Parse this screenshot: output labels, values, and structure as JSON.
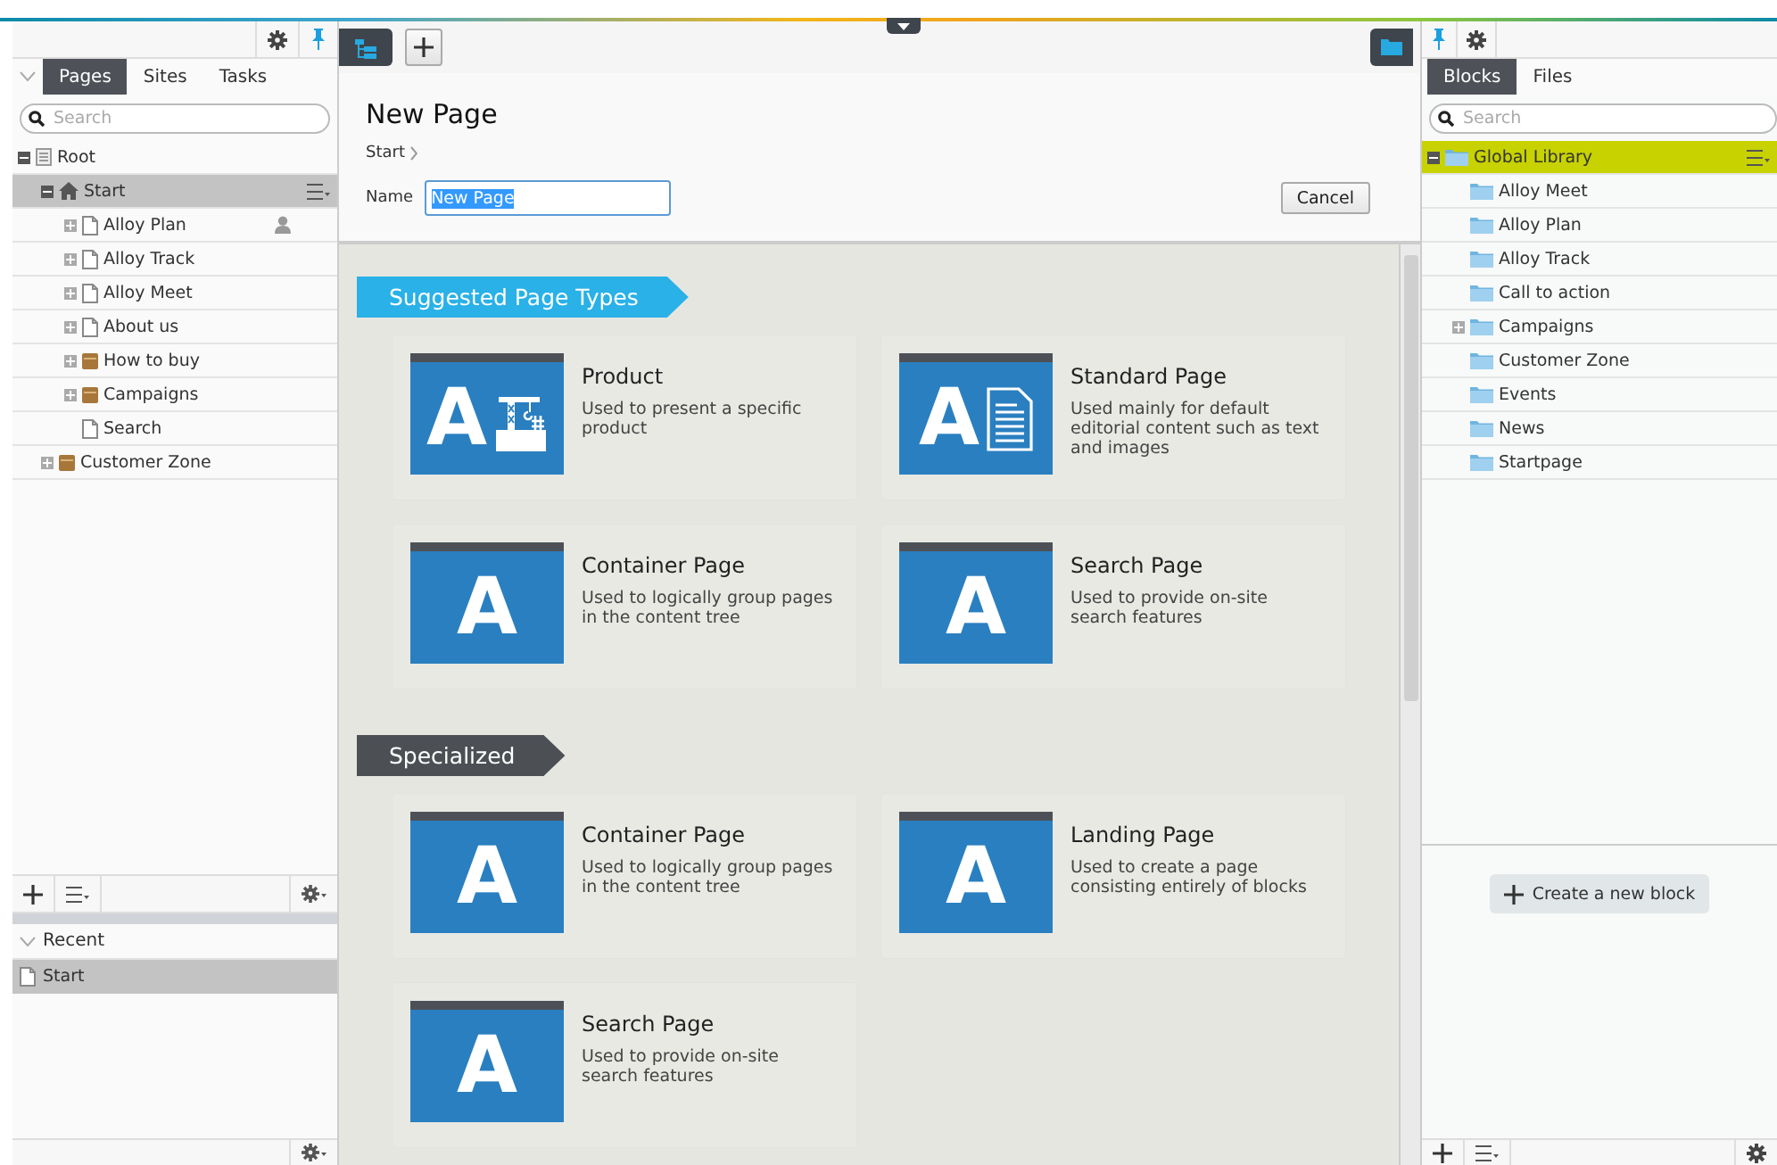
{
  "header_toggle": {
    "expanded": false
  },
  "left_pane": {
    "tabs": [
      {
        "label": "Pages",
        "selected": true
      },
      {
        "label": "Sites",
        "selected": false
      },
      {
        "label": "Tasks",
        "selected": false
      }
    ],
    "search": {
      "placeholder": "Search"
    },
    "tree": [
      {
        "label": "Root",
        "kind": "root",
        "has_children": true,
        "expanded": true,
        "selected": false,
        "in_use": false,
        "children": [
          {
            "label": "Start",
            "kind": "home",
            "has_children": true,
            "expanded": true,
            "selected": true,
            "in_use": false,
            "children": [
              {
                "label": "Alloy Plan",
                "kind": "page",
                "has_children": true,
                "expanded": false,
                "selected": false,
                "in_use": true
              },
              {
                "label": "Alloy Track",
                "kind": "page",
                "has_children": true,
                "expanded": false,
                "selected": false,
                "in_use": false
              },
              {
                "label": "Alloy Meet",
                "kind": "page",
                "has_children": true,
                "expanded": false,
                "selected": false,
                "in_use": false
              },
              {
                "label": "About us",
                "kind": "page",
                "has_children": true,
                "expanded": false,
                "selected": false,
                "in_use": false
              },
              {
                "label": "How to buy",
                "kind": "container",
                "has_children": true,
                "expanded": false,
                "selected": false,
                "in_use": false
              },
              {
                "label": "Campaigns",
                "kind": "container",
                "has_children": true,
                "expanded": false,
                "selected": false,
                "in_use": false
              },
              {
                "label": "Search",
                "kind": "page",
                "has_children": false,
                "selected": false,
                "in_use": false
              }
            ]
          },
          {
            "label": "Customer Zone",
            "kind": "container",
            "has_children": true,
            "expanded": false,
            "selected": false,
            "in_use": false
          }
        ]
      }
    ]
  },
  "recent": {
    "title": "Recent",
    "items": [
      {
        "label": "Start",
        "selected": true
      }
    ]
  },
  "main": {
    "title": "New Page",
    "breadcrumb": [
      {
        "label": "Start"
      }
    ],
    "name_field": {
      "label": "Name",
      "value": "New Page",
      "text_selected": true
    },
    "cancel_button": "Cancel",
    "sections": [
      {
        "title": "Suggested Page Types",
        "kind": "suggested",
        "page_types": [
          {
            "name": "Product",
            "description": "Used to present a specific product",
            "thumbnail_text": "A",
            "kind": "crane"
          },
          {
            "name": "Standard Page",
            "description": "Used mainly for default editorial content such as text and images",
            "thumbnail_text": "A",
            "kind": "document"
          },
          {
            "name": "Container Page",
            "description": "Used to logically group pages in the content tree",
            "thumbnail_text": "A",
            "kind": "plain"
          },
          {
            "name": "Search Page",
            "description": "Used to provide on-site search features",
            "thumbnail_text": "A",
            "kind": "plain"
          }
        ]
      },
      {
        "title": "Specialized",
        "kind": "other",
        "page_types": [
          {
            "name": "Container Page",
            "description": "Used to logically group pages in the content tree",
            "thumbnail_text": "A",
            "kind": "plain"
          },
          {
            "name": "Landing Page",
            "description": "Used to create a page consisting entirely of blocks",
            "thumbnail_text": "A",
            "kind": "plain"
          },
          {
            "name": "Search Page",
            "description": "Used to provide on-site search features",
            "thumbnail_text": "A",
            "kind": "plain"
          }
        ]
      }
    ]
  },
  "right_pane": {
    "tabs": [
      {
        "label": "Blocks",
        "selected": true
      },
      {
        "label": "Files",
        "selected": false
      }
    ],
    "search": {
      "placeholder": "Search"
    },
    "tree": [
      {
        "label": "Global Library",
        "has_children": true,
        "expanded": true,
        "selected": true,
        "children": [
          {
            "label": "Alloy Meet",
            "has_children": false,
            "selected": false
          },
          {
            "label": "Alloy Plan",
            "has_children": false,
            "selected": false
          },
          {
            "label": "Alloy Track",
            "has_children": false,
            "selected": false
          },
          {
            "label": "Call to action",
            "has_children": false,
            "selected": false
          },
          {
            "label": "Campaigns",
            "has_children": true,
            "expanded": false,
            "selected": false
          },
          {
            "label": "Customer Zone",
            "has_children": false,
            "selected": false
          },
          {
            "label": "Events",
            "has_children": false,
            "selected": false
          },
          {
            "label": "News",
            "has_children": false,
            "selected": false
          },
          {
            "label": "Startpage",
            "has_children": false,
            "selected": false
          }
        ]
      }
    ],
    "create_button": "Create a new block"
  }
}
